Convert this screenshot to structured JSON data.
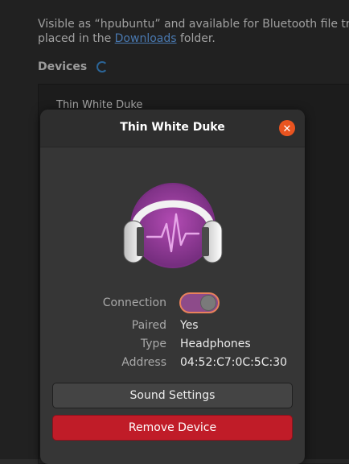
{
  "background": {
    "info_text_1": "Visible as “hpubuntu” and available for Bluetooth file tra",
    "info_text_2_prefix": "placed in the ",
    "info_link": "Downloads",
    "info_text_2_suffix": " folder.",
    "devices_heading": "Devices",
    "device_list_first": "Thin White Duke"
  },
  "dialog": {
    "title": "Thin White Duke",
    "close_icon": "close-icon",
    "device_icon": "headphones-icon",
    "properties": {
      "connection_label": "Connection",
      "connection_on": true,
      "paired_label": "Paired",
      "paired_value": "Yes",
      "type_label": "Type",
      "type_value": "Headphones",
      "address_label": "Address",
      "address_value": "04:52:C7:0C:5C:30"
    },
    "sound_settings_label": "Sound Settings",
    "remove_device_label": "Remove Device"
  },
  "colors": {
    "accent_orange": "#e95420",
    "toggle_purple": "#8d4b8a",
    "destructive_red": "#c01c28",
    "link_blue": "#62a0ea"
  }
}
